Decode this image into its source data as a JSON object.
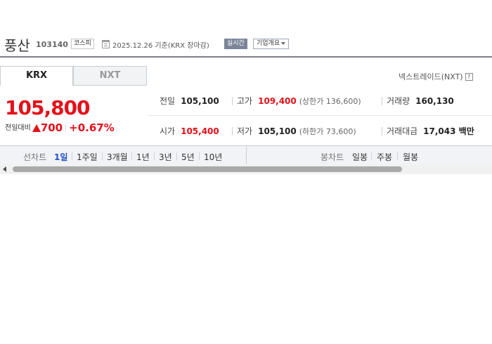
{
  "header": {
    "stock_name": "풍산",
    "stock_code": "103140",
    "market": "코스피",
    "date_text": "2025.12.26  기준(KRX 장마감)",
    "realtime_label": "실시간",
    "company_overview_label": "기업개요"
  },
  "tabs": [
    {
      "label": "KRX",
      "active": true
    },
    {
      "label": "NXT",
      "active": false
    }
  ],
  "nextrade_link": "넥스트레이드(NXT)",
  "help_icon_text": "?",
  "price": {
    "current": "105,800",
    "change_label": "전일대비",
    "change_value": "700",
    "change_pct": "+0.67%",
    "direction": "up"
  },
  "quotes": {
    "prev_close": {
      "label": "전일",
      "value": "105,100"
    },
    "high": {
      "label": "고가",
      "value": "109,400",
      "sub": "(상한가 136,600)"
    },
    "volume": {
      "label": "거래량",
      "value": "160,130"
    },
    "open": {
      "label": "시가",
      "value": "105,400"
    },
    "low": {
      "label": "저가",
      "value": "105,100",
      "sub": "(하한가 73,600)"
    },
    "trade_value": {
      "label": "거래대금",
      "value": "17,043 백만"
    }
  },
  "chart_controls": {
    "line_title": "선차트",
    "line_periods": [
      "1일",
      "1주일",
      "3개월",
      "1년",
      "3년",
      "5년",
      "10년"
    ],
    "active_period": "1일",
    "candle_title": "봉차트",
    "candle_periods": [
      "일봉",
      "주봉",
      "월봉"
    ]
  },
  "colors": {
    "up": "#e4101a",
    "active_link": "#1f4fc8",
    "realtime_badge": "#7b8499"
  }
}
